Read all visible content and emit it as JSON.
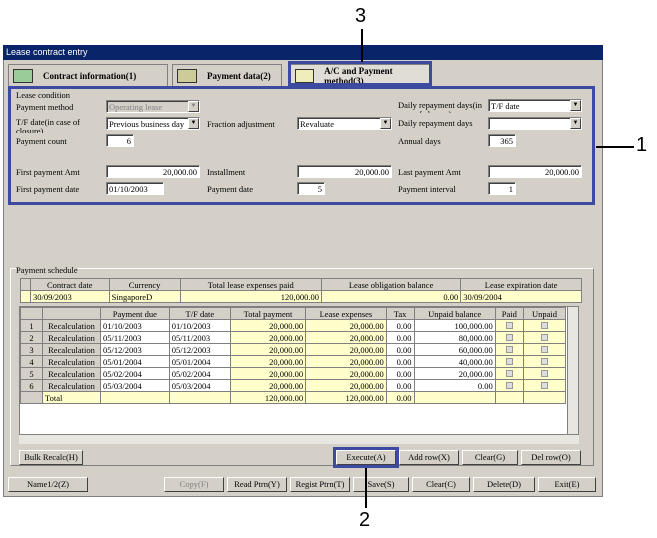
{
  "window": {
    "title": "Lease contract entry"
  },
  "tabs": [
    {
      "label": "Contract information(1)"
    },
    {
      "label": "Payment data(2)"
    },
    {
      "label": "A/C and Payment method(3)"
    }
  ],
  "lease_condition": {
    "group_label": "Lease condition",
    "payment_method_label": "Payment method",
    "payment_method_value": "Operating lease",
    "tf_date_label": "T/F date(in case of closure)",
    "tf_date_value": "Previous business day",
    "fraction_label": "Fraction adjustment",
    "fraction_value": "Revaluate",
    "payment_count_label": "Payment count",
    "payment_count_value": "6",
    "daily_repay_label1": "Daily repayment days(in case of closure)",
    "daily_repay_value1": "T/F date",
    "daily_repay_label2": "Daily repayment days",
    "daily_repay_value2": "",
    "annual_days_label": "Annual days",
    "annual_days_value": "365",
    "first_amt_label": "First payment Amt",
    "first_amt_value": "20,000.00",
    "installment_label": "Installment",
    "installment_value": "20,000.00",
    "last_amt_label": "Last payment Amt",
    "last_amt_value": "20,000.00",
    "first_date_label": "First payment date",
    "first_date_value": "01/10/2003",
    "payment_date_label": "Payment date",
    "payment_date_value": "5",
    "interval_label": "Payment interval",
    "interval_value": "1"
  },
  "schedule": {
    "group_label": "Payment schedule",
    "summary_headers": [
      "Contract date",
      "Currency",
      "Total lease expenses paid",
      "Lease obligation balance",
      "Lease expiration date"
    ],
    "summary_row": [
      "30/09/2003",
      "SingaporeD",
      "120,000.00",
      "0.00",
      "30/09/2004"
    ],
    "headers": [
      "",
      "",
      "Payment due",
      "T/F date",
      "Total payment",
      "Lease expenses",
      "Tax",
      "Unpaid balance",
      "Paid",
      "Unpaid"
    ],
    "rows": [
      {
        "no": "1",
        "btn": "Recalculation",
        "due": "01/10/2003",
        "tf": "01/10/2003",
        "total": "20,000.00",
        "lease": "20,000.00",
        "tax": "0.00",
        "unpaid": "100,000.00"
      },
      {
        "no": "2",
        "btn": "Recalculation",
        "due": "05/11/2003",
        "tf": "05/11/2003",
        "total": "20,000.00",
        "lease": "20,000.00",
        "tax": "0.00",
        "unpaid": "80,000.00"
      },
      {
        "no": "3",
        "btn": "Recalculation",
        "due": "05/12/2003",
        "tf": "05/12/2003",
        "total": "20,000.00",
        "lease": "20,000.00",
        "tax": "0.00",
        "unpaid": "60,000.00"
      },
      {
        "no": "4",
        "btn": "Recalculation",
        "due": "05/01/2004",
        "tf": "05/01/2004",
        "total": "20,000.00",
        "lease": "20,000.00",
        "tax": "0.00",
        "unpaid": "40,000.00"
      },
      {
        "no": "5",
        "btn": "Recalculation",
        "due": "05/02/2004",
        "tf": "05/02/2004",
        "total": "20,000.00",
        "lease": "20,000.00",
        "tax": "0.00",
        "unpaid": "20,000.00"
      },
      {
        "no": "6",
        "btn": "Recalculation",
        "due": "05/03/2004",
        "tf": "05/03/2004",
        "total": "20,000.00",
        "lease": "20,000.00",
        "tax": "0.00",
        "unpaid": "0.00"
      }
    ],
    "total_row": {
      "label": "Total",
      "total": "120,000.00",
      "lease": "120,000.00",
      "tax": "0.00"
    }
  },
  "row_buttons": {
    "bulk": "Bulk Recalc(H)",
    "execute": "Execute(A)",
    "add": "Add row(X)",
    "clear": "Clear(G)",
    "del": "Del row(O)"
  },
  "footer_buttons": {
    "name": "Name1/2(Z)",
    "copy": "Copy(F)",
    "read": "Read Ptrn(Y)",
    "regist": "Regist Ptrn(T)",
    "save": "Save(S)",
    "clear": "Clear(C)",
    "delete": "Delete(D)",
    "exit": "Exit(E)"
  },
  "callouts": {
    "c1": "1",
    "c2": "2",
    "c3": "3"
  }
}
